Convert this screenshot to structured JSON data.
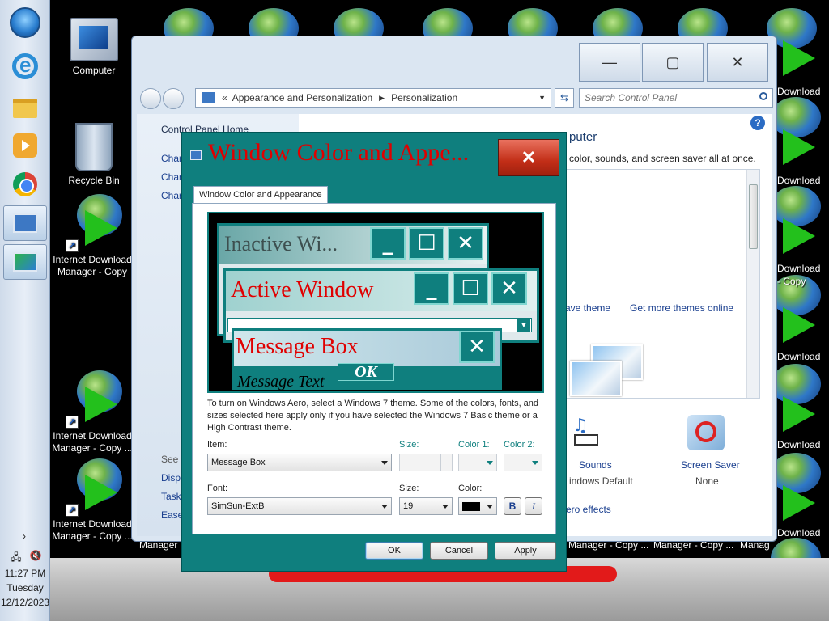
{
  "taskbar": {
    "clock_time": "11:27 PM",
    "clock_day": "Tuesday",
    "clock_date": "12/12/2023",
    "items": [
      "start-orb",
      "internet-explorer",
      "windows-explorer",
      "media-player",
      "chrome",
      "control-panel",
      "personalization"
    ]
  },
  "desktop": {
    "icons": [
      {
        "label": "Computer"
      },
      {
        "label": "Recycle Bin"
      },
      {
        "label_line1": "Internet Download",
        "label_line2": "Manager - Copy"
      },
      {
        "label_line1": "Internet Download",
        "label_line2": "Manager - Copy ..."
      },
      {
        "label_line1": "Internet Download",
        "label_line2": "Manager - Copy ..."
      }
    ],
    "right_labels": [
      "Download",
      "Download",
      "Download",
      "- Copy",
      "Download",
      "Download",
      "Download"
    ],
    "bottom_labels": [
      "Manager - ...",
      "Manager - Copy ...",
      "Manager - Copy ...",
      "Manag"
    ]
  },
  "control_panel": {
    "breadcrumb_root": "Appearance and Personalization",
    "breadcrumb_current": "Personalization",
    "search_placeholder": "Search Control Panel",
    "left_links": [
      "Control Panel Home",
      "Char",
      "Char",
      "Char"
    ],
    "see_also": "See a",
    "bottom_links": [
      "Displ",
      "Task",
      "Ease"
    ],
    "heading_fragment": "puter",
    "intro_fragment": "color, sounds, and screen saver all at once.",
    "save_theme": "ave theme",
    "more_themes": "Get more themes online",
    "sounds_label": "Sounds",
    "sounds_value": "indows Default",
    "saver_label": "Screen Saver",
    "saver_value": "None",
    "aero_link": "ero effects"
  },
  "dialog": {
    "title": "Window Color and Appe...",
    "tab_label": "Window Color and Appearance",
    "preview": {
      "inactive_title": "Inactive Wi...",
      "active_title": "Active Window",
      "message_title": "Message Box",
      "message_text": "Message Text",
      "ok_label": "OK",
      "min_glyph": "_",
      "max_glyph": "☐",
      "close_glyph": "✕"
    },
    "description": "To turn on Windows Aero, select a Windows 7 theme.  Some of the colors, fonts, and sizes selected here apply only if you have selected the Windows 7 Basic theme or a High Contrast theme.",
    "item_label": "Item:",
    "item_value": "Message Box",
    "size_label": "Size:",
    "color1_label": "Color 1:",
    "color2_label": "Color 2:",
    "font_label": "Font:",
    "font_value": "SimSun-ExtB",
    "font_size_label": "Size:",
    "font_size_value": "19",
    "color_label": "Color:",
    "bold_label": "B",
    "italic_label": "I",
    "ok_button": "OK",
    "cancel_button": "Cancel",
    "apply_button": "Apply"
  },
  "colors": {
    "dialog_teal": "#0f7f7e",
    "title_red": "#e00000"
  }
}
